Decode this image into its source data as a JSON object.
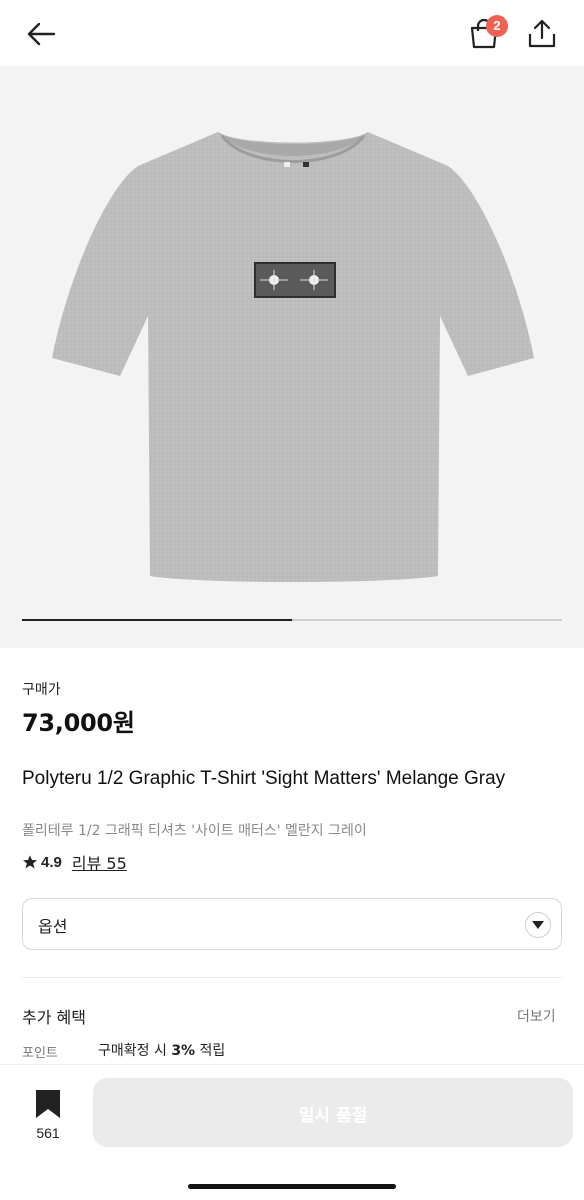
{
  "header": {
    "back_icon": "arrow-left-icon",
    "bag_icon": "shopping-bag-icon",
    "bag_badge": "2",
    "share_icon": "share-upload-icon",
    "badge_color": "#ef6253"
  },
  "gallery": {
    "image": "gray-tshirt-with-graphic",
    "progress_fraction": 0.5
  },
  "price": {
    "label": "구매가",
    "value": "73,000원"
  },
  "product": {
    "title_en": "Polyteru 1/2 Graphic T-Shirt 'Sight Matters' Melange Gray",
    "title_ko": "폴리테루 1/2 그래픽 티셔츠 '사이트 매터스' 멜란지 그레이",
    "rating": "4.9",
    "review_text": "리뷰 55"
  },
  "option": {
    "label": "옵션",
    "arrow_icon": "chevron-down-icon"
  },
  "benefits": {
    "title": "추가 혜택",
    "more": "더보기",
    "point_label": "포인트",
    "point_prefix": "구매확정 시 ",
    "point_rate": "3%",
    "point_suffix": " 적립"
  },
  "bottom": {
    "wish_icon": "bookmark-icon",
    "wish_count": "561",
    "soldout_label": "일시 품절"
  }
}
